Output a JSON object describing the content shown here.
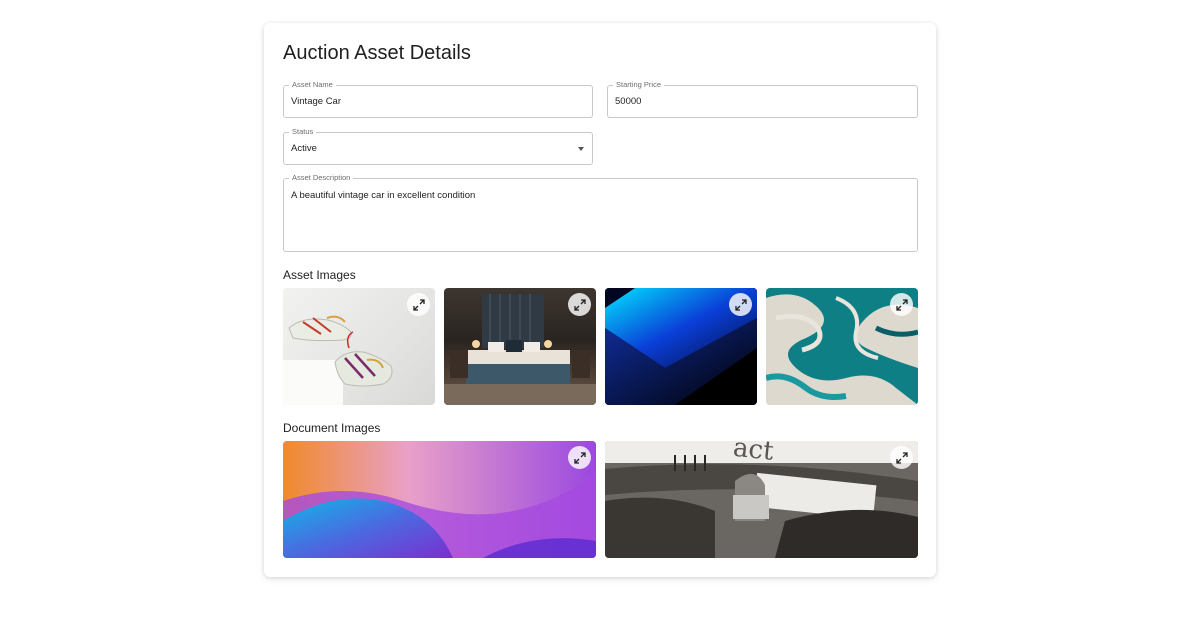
{
  "page": {
    "title": "Auction Asset Details"
  },
  "form": {
    "asset_name": {
      "label": "Asset Name",
      "value": "Vintage Car"
    },
    "starting_price": {
      "label": "Starting Price",
      "value": "50000"
    },
    "status": {
      "label": "Status",
      "value": "Active"
    },
    "asset_description": {
      "label": "Asset Description",
      "value": "A beautiful vintage car in excellent condition"
    }
  },
  "sections": {
    "asset_images": "Asset Images",
    "document_images": "Document Images"
  },
  "asset_images": [
    {
      "subject": "sneakers",
      "icon": "expand-icon"
    },
    {
      "subject": "bedroom",
      "icon": "expand-icon"
    },
    {
      "subject": "blue-abstract",
      "icon": "expand-icon"
    },
    {
      "subject": "teal-marble",
      "icon": "expand-icon"
    }
  ],
  "document_images": [
    {
      "subject": "purple-gradient",
      "icon": "expand-icon"
    },
    {
      "subject": "typewriter",
      "icon": "expand-icon"
    }
  ],
  "colors": {
    "border": "#c8c8c8",
    "label": "#6d6d6d",
    "text": "#1f1f1f"
  }
}
